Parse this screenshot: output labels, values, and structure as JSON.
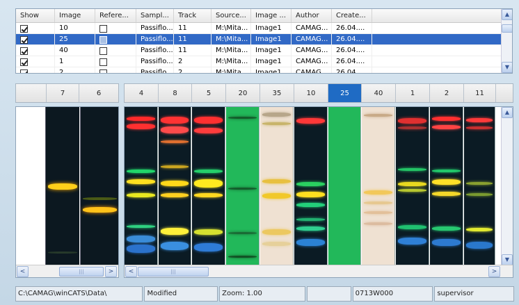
{
  "table": {
    "columns": [
      "Show",
      "Image",
      "Refere...",
      "Sampl...",
      "Track",
      "Source...",
      "Image ...",
      "Author",
      "Create..."
    ],
    "rows": [
      {
        "show": true,
        "image": "10",
        "ref": false,
        "sample": "Passiflo...",
        "track": "11",
        "source": "M:\\Mita...",
        "imagename": "Image1",
        "author": "CAMAG...",
        "created": "26.04....",
        "selected": false
      },
      {
        "show": true,
        "image": "25",
        "ref": false,
        "sample": "Passiflo...",
        "track": "11",
        "source": "M:\\Mita...",
        "imagename": "Image1",
        "author": "CAMAG...",
        "created": "26.04....",
        "selected": true
      },
      {
        "show": true,
        "image": "40",
        "ref": false,
        "sample": "Passiflo...",
        "track": "11",
        "source": "M:\\Mita...",
        "imagename": "Image1",
        "author": "CAMAG...",
        "created": "26.04....",
        "selected": false
      },
      {
        "show": true,
        "image": "1",
        "ref": false,
        "sample": "Passiflo...",
        "track": "2",
        "source": "M:\\Mita...",
        "imagename": "Image1",
        "author": "CAMAG...",
        "created": "26.04....",
        "selected": false
      },
      {
        "show": true,
        "image": "2",
        "ref": false,
        "sample": "Passiflo...",
        "track": "2",
        "source": "M:\\Mita...",
        "imagename": "Image1",
        "author": "CAMAG...",
        "created": "26.04....",
        "selected": false
      }
    ]
  },
  "reference_lanes": {
    "labels": [
      "",
      "7",
      "6"
    ]
  },
  "sample_lanes": {
    "labels": [
      "4",
      "8",
      "5",
      "20",
      "35",
      "10",
      "25",
      "40",
      "1",
      "2",
      "11"
    ],
    "selected": "25"
  },
  "scroll": {
    "left_arrow": "<",
    "right_arrow": ">",
    "up_arrow": "^",
    "down_arrow": "v"
  },
  "status": {
    "path": "C:\\CAMAG\\winCATS\\Data\\",
    "state": "Modified",
    "zoom": "Zoom: 1.00",
    "empty": "",
    "id": "0713W000",
    "user": "supervisor"
  },
  "colors": {
    "selection": "#3169c6",
    "lane_header_selected": "#1f6bc4",
    "plate_dark": "#0d1a22",
    "plate_green": "#22b85a",
    "plate_beige": "#efe1d2"
  }
}
